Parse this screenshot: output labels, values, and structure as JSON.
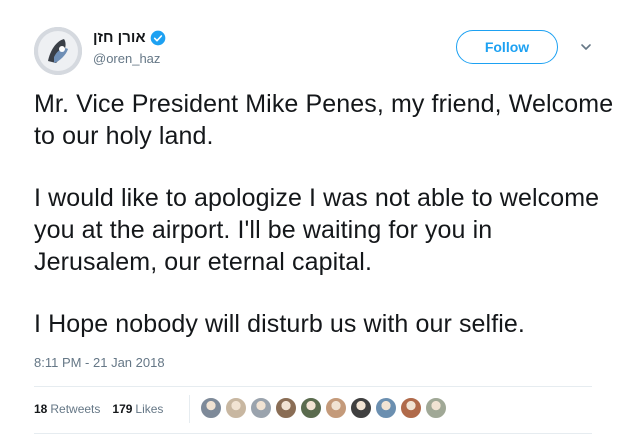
{
  "author": {
    "display_name": "אורן חזן",
    "handle": "@oren_haz",
    "verified": true,
    "avatar_icon": "user-avatar"
  },
  "actions": {
    "follow_label": "Follow",
    "more_icon": "chevron-down-icon"
  },
  "tweet": {
    "paragraphs": [
      "Mr. Vice President Mike Penes, my friend, Welcome to our holy land.",
      "I would like to apologize I was not able to welcome you at the airport. I'll be waiting for you in Jerusalem, our eternal capital.",
      "I Hope nobody will disturb us with our selfie."
    ],
    "timestamp": "8:11 PM - 21 Jan 2018"
  },
  "stats": {
    "retweets_count": "18",
    "retweets_label": "Retweets",
    "likes_count": "179",
    "likes_label": "Likes"
  },
  "likers": [
    {
      "name": "liker-avatar-1",
      "color": "#7e8a99"
    },
    {
      "name": "liker-avatar-2",
      "color": "#c8b7a1"
    },
    {
      "name": "liker-avatar-3",
      "color": "#9aa3ad"
    },
    {
      "name": "liker-avatar-4",
      "color": "#8a6d55"
    },
    {
      "name": "liker-avatar-5",
      "color": "#5a6b4e"
    },
    {
      "name": "liker-avatar-6",
      "color": "#c49a7a"
    },
    {
      "name": "liker-avatar-7",
      "color": "#3f3f3f"
    },
    {
      "name": "liker-avatar-8",
      "color": "#6b8fb0"
    },
    {
      "name": "liker-avatar-9",
      "color": "#b06a4a"
    },
    {
      "name": "liker-avatar-10",
      "color": "#a0a896"
    }
  ],
  "colors": {
    "accent": "#1da1f2",
    "text": "#14171a",
    "muted": "#657786",
    "border": "#e6ecf0"
  }
}
